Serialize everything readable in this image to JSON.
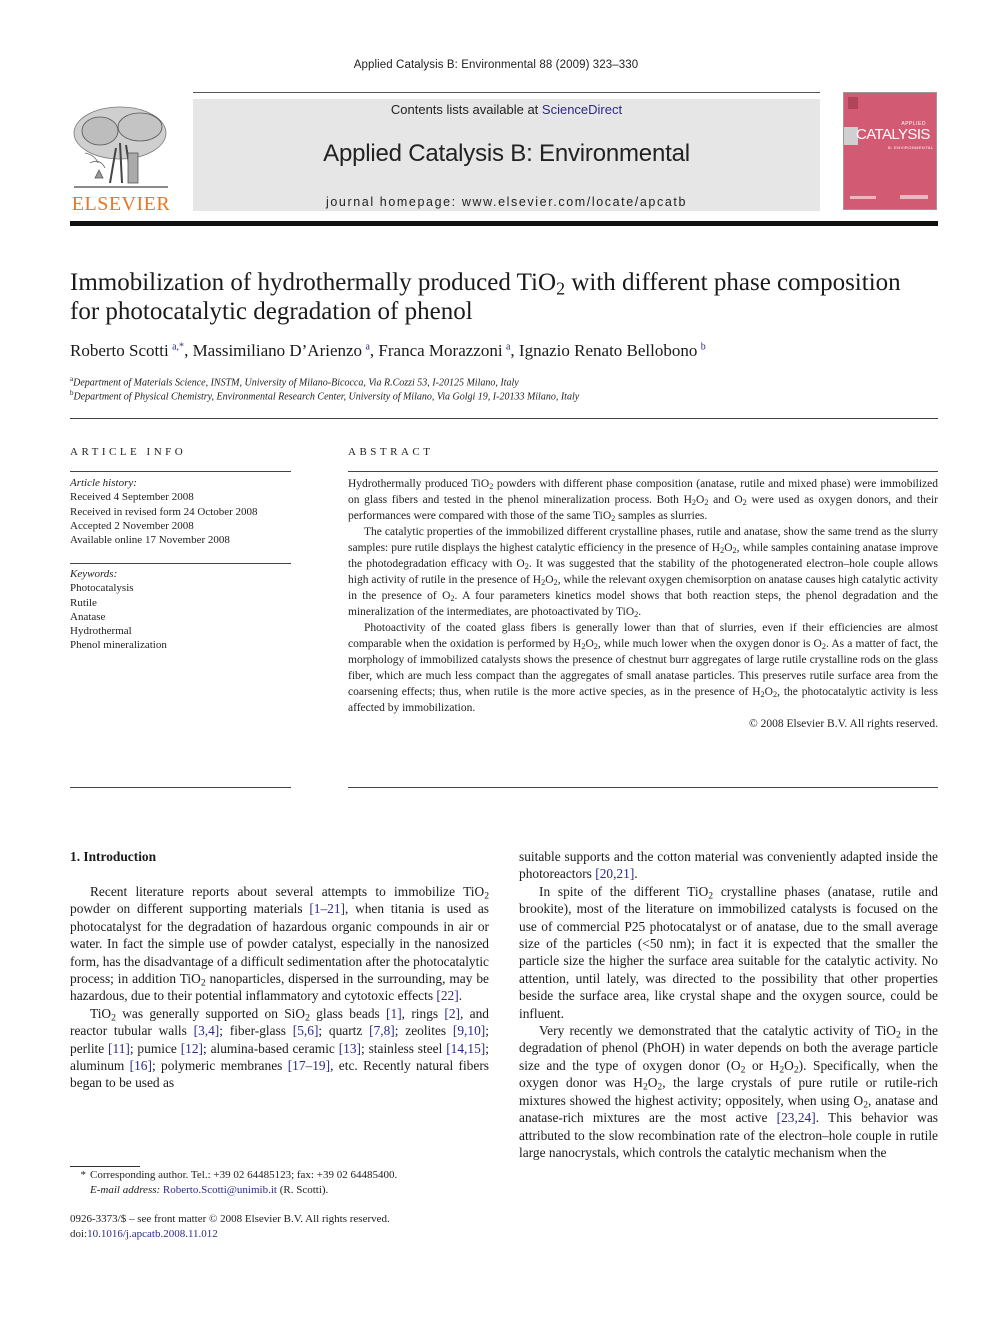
{
  "running_head": "Applied Catalysis B: Environmental 88 (2009) 323–330",
  "header": {
    "contents_prefix": "Contents lists available at ",
    "contents_link": "ScienceDirect",
    "journal_name": "Applied Catalysis B: Environmental",
    "homepage_prefix": "journal homepage: ",
    "homepage_url": "www.elsevier.com/locate/apcatb",
    "publisher_logo_text": "ELSEVIER",
    "cover": {
      "applied": "APPLIED",
      "catalysis": "CATALYSIS",
      "subtitle": "B: ENVIRONMENTAL",
      "color": "#d25a72"
    }
  },
  "article": {
    "title_part1": "Immobilization of hydrothermally produced TiO",
    "title_sub": "2",
    "title_part2": " with different phase composition for photocatalytic degradation of phenol",
    "authors": [
      {
        "name": "Roberto Scotti",
        "sup": "a,*"
      },
      {
        "name": "Massimiliano D’Arienzo",
        "sup": "a"
      },
      {
        "name": "Franca Morazzoni",
        "sup": "a"
      },
      {
        "name": "Ignazio Renato Bellobono",
        "sup": "b"
      }
    ],
    "affiliations": [
      {
        "key": "a",
        "text": "Department of Materials Science, INSTM, University of Milano-Bicocca, Via R.Cozzi 53, I-20125 Milano, Italy"
      },
      {
        "key": "b",
        "text": "Department of Physical Chemistry, Environmental Research Center, University of Milano, Via Golgi 19, I-20133 Milano, Italy"
      }
    ]
  },
  "article_info": {
    "label": "ARTICLE INFO",
    "history_heading": "Article history:",
    "history": [
      "Received 4 September 2008",
      "Received in revised form 24 October 2008",
      "Accepted 2 November 2008",
      "Available online 17 November 2008"
    ],
    "keywords_heading": "Keywords:",
    "keywords": [
      "Photocatalysis",
      "Rutile",
      "Anatase",
      "Hydrothermal",
      "Phenol mineralization"
    ]
  },
  "abstract": {
    "label": "ABSTRACT",
    "copyright": "© 2008 Elsevier B.V. All rights reserved."
  },
  "intro": {
    "heading": "1.  Introduction"
  },
  "footnote": {
    "star": "*",
    "corresponding": "Corresponding author. Tel.: +39 02 64485123; fax: +39 02 64485400.",
    "email_label": "E-mail address: ",
    "email": "Roberto.Scotti@unimib.it",
    "email_suffix": " (R. Scotti)."
  },
  "frontmatter": {
    "issn_line": "0926-3373/$ – see front matter © 2008 Elsevier B.V. All rights reserved.",
    "doi_prefix": "doi:",
    "doi": "10.1016/j.apcatb.2008.11.012"
  },
  "colors": {
    "link": "#2a2a8a",
    "elsevier_orange": "#e87722",
    "banner_gray": "#e6e6e6"
  }
}
